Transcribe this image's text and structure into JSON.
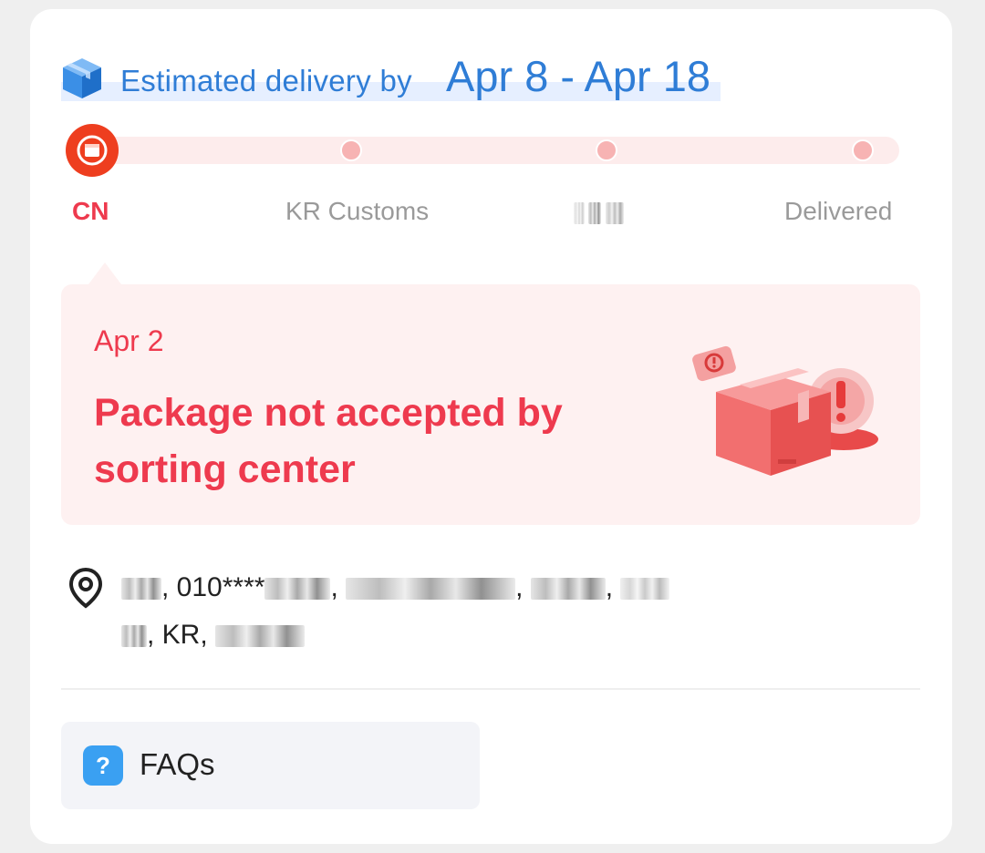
{
  "delivery": {
    "label": "Estimated delivery by",
    "dates": "Apr 8 - Apr 18"
  },
  "progress": {
    "steps": [
      {
        "label": "CN",
        "active": true
      },
      {
        "label": "KR Customs",
        "active": false
      },
      {
        "label": "",
        "active": false
      },
      {
        "label": "Delivered",
        "active": false
      }
    ]
  },
  "status": {
    "date": "Apr 2",
    "message": "Package not accepted by sorting center"
  },
  "address": {
    "line1_phone": "010****",
    "line2_country": "KR,"
  },
  "faq": {
    "label": "FAQs",
    "icon": "?"
  },
  "colors": {
    "accent_blue": "#2f7dd6",
    "status_red": "#ee3a4e",
    "current_step": "#ee3e1f",
    "panel_bg": "#fef1f1"
  }
}
